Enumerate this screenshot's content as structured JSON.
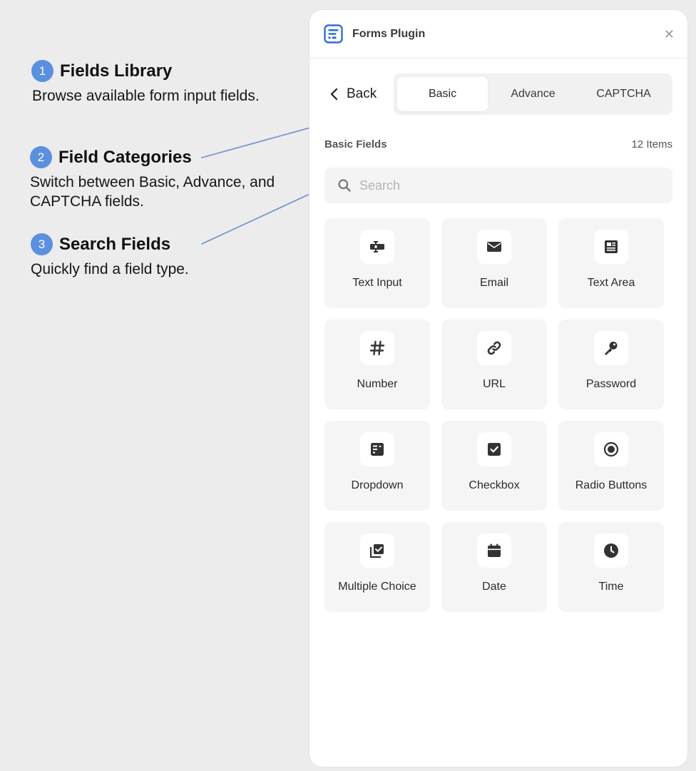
{
  "annotations": [
    {
      "number": "1",
      "title": "Fields Library",
      "description": "Browse available form input fields."
    },
    {
      "number": "2",
      "title": "Field Categories",
      "description": "Switch between Basic, Advance, and CAPTCHA fields."
    },
    {
      "number": "3",
      "title": "Search Fields",
      "description": "Quickly find a field type."
    }
  ],
  "colors": {
    "accent": "#5b8fe0",
    "arrow": "#6f90c8",
    "icon": "#333333",
    "logo": "#2f6fd6"
  },
  "panel": {
    "title": "Forms Plugin",
    "close_icon": "✕",
    "back_label": "Back",
    "tabs": [
      {
        "label": "Basic",
        "active": true
      },
      {
        "label": "Advance",
        "active": false
      },
      {
        "label": "CAPTCHA",
        "active": false
      }
    ],
    "section_title": "Basic Fields",
    "item_count": "12 Items",
    "search_placeholder": "Search",
    "search_value": "",
    "fields": [
      {
        "label": "Text Input",
        "icon": "text-input-icon"
      },
      {
        "label": "Email",
        "icon": "email-icon"
      },
      {
        "label": "Text Area",
        "icon": "text-area-icon"
      },
      {
        "label": "Number",
        "icon": "hash-icon"
      },
      {
        "label": "URL",
        "icon": "link-icon"
      },
      {
        "label": "Password",
        "icon": "key-icon"
      },
      {
        "label": "Dropdown",
        "icon": "dropdown-icon"
      },
      {
        "label": "Checkbox",
        "icon": "checkbox-icon"
      },
      {
        "label": "Radio Buttons",
        "icon": "radio-icon"
      },
      {
        "label": "Multiple Choice",
        "icon": "multiple-choice-icon"
      },
      {
        "label": "Date",
        "icon": "calendar-icon"
      },
      {
        "label": "Time",
        "icon": "clock-icon"
      }
    ]
  }
}
